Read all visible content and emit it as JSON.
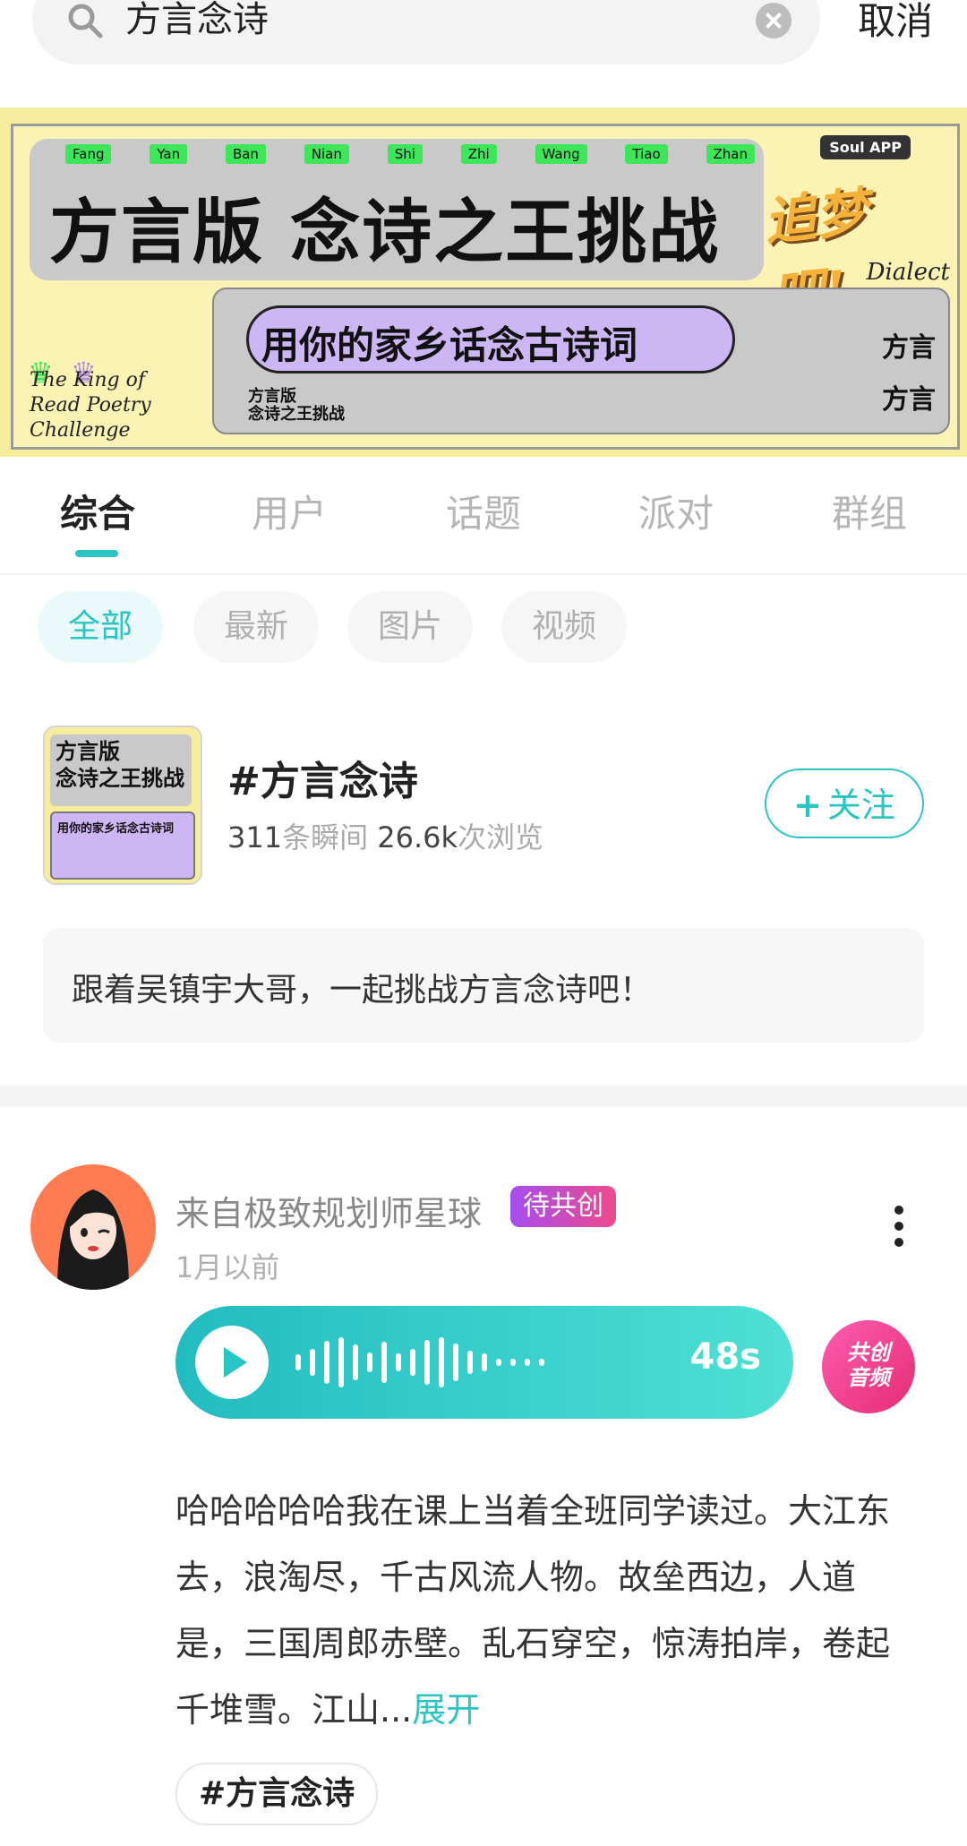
{
  "search": {
    "query": "方言念诗",
    "cancel_label": "取消"
  },
  "banner": {
    "pinyin": [
      "Fang",
      "Yan",
      "Ban",
      "Nian",
      "Shi",
      "Zhi",
      "Wang",
      "Tiao",
      "Zhan"
    ],
    "title": "方言版 念诗之王挑战",
    "soul_badge": "Soul APP",
    "logo_text": "追梦吧!",
    "dialect_label": "Dialect",
    "subtitle": "用你的家乡话念古诗词",
    "mini_title_1": "方言版",
    "mini_title_2": "念诗之王挑战",
    "king_text_1": "The King of",
    "king_text_2": "Read Poetry",
    "king_text_3": "Challenge",
    "fangyan": "方言"
  },
  "tabs": [
    {
      "label": "综合",
      "active": true
    },
    {
      "label": "用户"
    },
    {
      "label": "话题"
    },
    {
      "label": "派对"
    },
    {
      "label": "群组"
    }
  ],
  "filters": [
    {
      "label": "全部",
      "active": true
    },
    {
      "label": "最新"
    },
    {
      "label": "图片"
    },
    {
      "label": "视频"
    }
  ],
  "topic": {
    "title": "#方言念诗",
    "moments_count": "311",
    "moments_unit": "条瞬间",
    "views_count": "26.6k",
    "views_unit": "次浏览",
    "follow_label": "关注",
    "follow_plus": "+",
    "thumb_title": "方言版\n念诗之王挑战",
    "thumb_subtitle": "用你的家乡话念古诗词",
    "description": "跟着吴镇宇大哥，一起挑战方言念诗吧！"
  },
  "post": {
    "author": "来自极致规划师星球",
    "badge": "待共创",
    "time": "1月以前",
    "audio_duration": "48s",
    "cocreate_label_1": "共创",
    "cocreate_label_2": "音频",
    "text": "哈哈哈哈哈我在课上当着全班同学读过。大江东去，浪淘尽，千古风流人物。故垒西边，人道是，三国周郎赤壁。乱石穿空，惊涛拍岸，卷起千堆雪。江山...",
    "expand_label": "展开",
    "tag": "#方言念诗"
  },
  "colors": {
    "accent": "#29c5c5",
    "badge_start": "#a64df0",
    "badge_end": "#ee4a8a"
  },
  "icons": {
    "search": "search-icon",
    "clear": "clear-icon",
    "more": "more-vertical-icon",
    "play": "play-icon"
  }
}
